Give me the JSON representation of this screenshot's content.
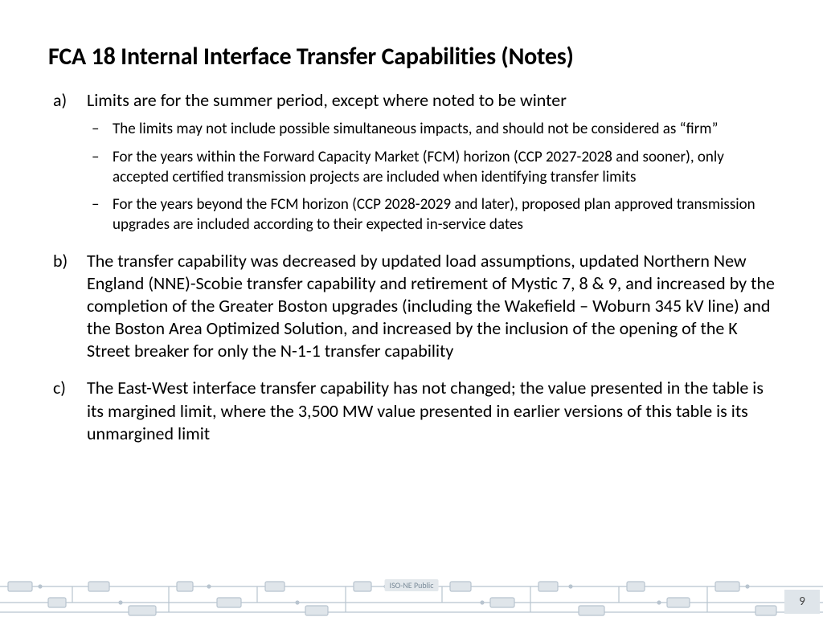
{
  "title": "FCA 18 Internal Interface Transfer Capabilities (Notes)",
  "items": [
    {
      "marker": "a)",
      "text": "Limits are for the summer period, except where noted to be winter",
      "sub": [
        "The limits may not include possible simultaneous impacts, and should not be considered as “firm”",
        "For the years within the Forward Capacity Market (FCM) horizon (CCP 2027-2028 and sooner), only accepted certified transmission projects are included when identifying transfer limits",
        "For the years beyond the FCM horizon (CCP 2028-2029 and later), proposed plan approved transmission upgrades are included according to their expected in-service dates"
      ]
    },
    {
      "marker": "b)",
      "text": "The transfer capability was decreased by updated load assumptions, updated Northern New England (NNE)-Scobie transfer capability and retirement of Mystic 7, 8 & 9, and increased by the completion of the Greater Boston upgrades (including the Wakefield – Woburn 345 kV line) and the Boston Area Optimized Solution, and increased by the inclusion of the opening of the K Street breaker for only the N-1-1 transfer capability",
      "sub": []
    },
    {
      "marker": "c)",
      "text": "The East-West interface transfer capability has not changed; the value presented in the table is its margined limit, where the 3,500 MW value presented in earlier versions of this table is its unmargined limit",
      "sub": []
    }
  ],
  "classification": "ISO-NE Public",
  "page_number": "9"
}
